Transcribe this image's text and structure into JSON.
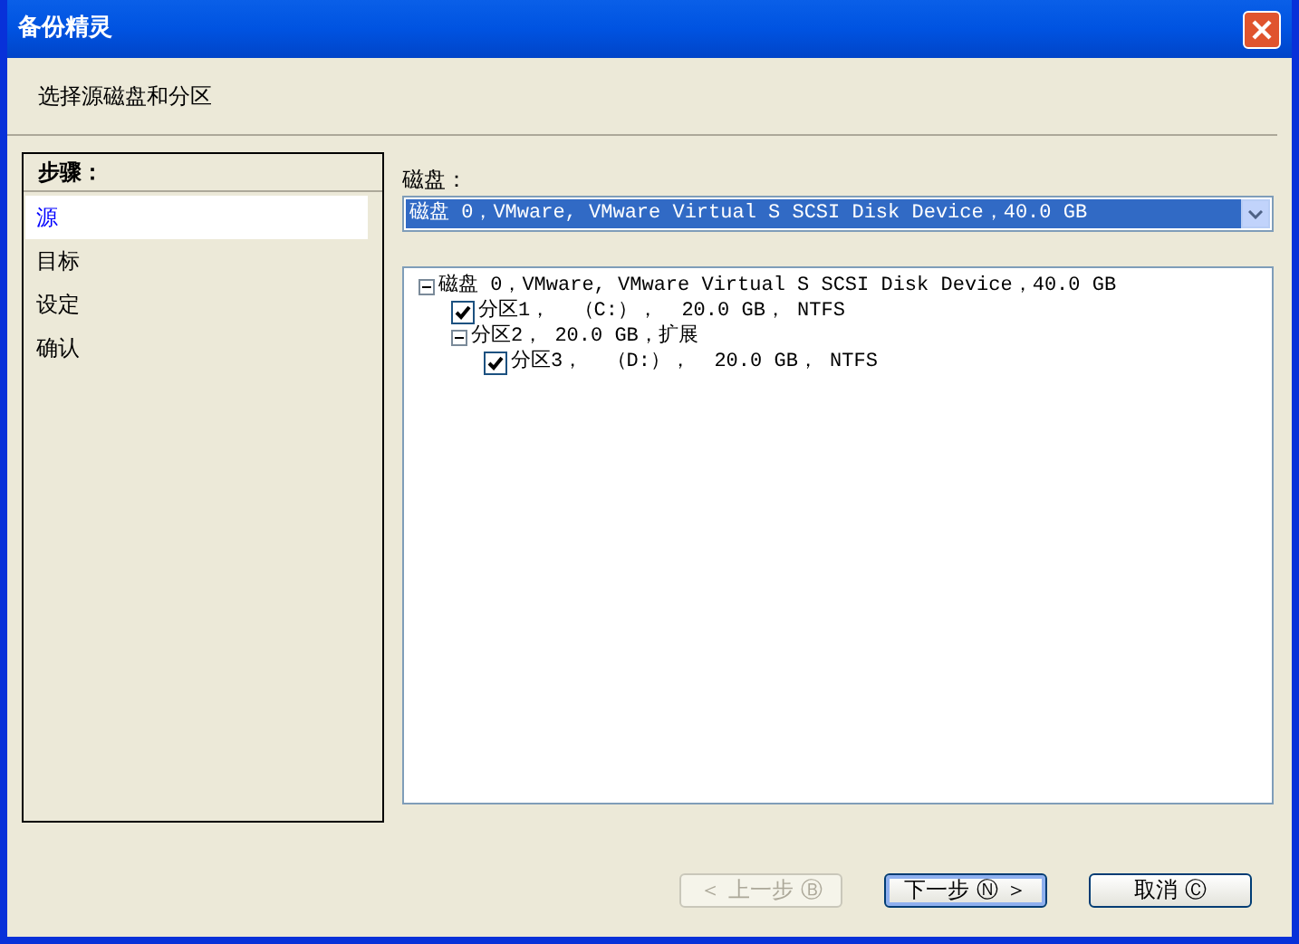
{
  "window": {
    "title": "备份精灵"
  },
  "header": {
    "subtitle": "选择源磁盘和分区"
  },
  "steps": {
    "title": "步骤：",
    "items": [
      {
        "label": "源",
        "selected": true
      },
      {
        "label": "目标",
        "selected": false
      },
      {
        "label": "设定",
        "selected": false
      },
      {
        "label": "确认",
        "selected": false
      }
    ]
  },
  "disk": {
    "label": "磁盘：",
    "value": "磁盘 0，VMware, VMware Virtual S SCSI Disk Device，40.0 GB"
  },
  "tree": [
    {
      "kind": "expandable",
      "label": "磁盘 0，VMware, VMware Virtual S SCSI Disk Device，40.0 GB",
      "expanded": true,
      "children": [
        {
          "kind": "checkable",
          "label": "分区1，  （C:），  20.0 GB， NTFS",
          "checked": true
        },
        {
          "kind": "expandable",
          "label": "分区2， 20.0 GB，扩展",
          "expanded": true,
          "children": [
            {
              "kind": "checkable",
              "label": "分区3，  （D:），  20.0 GB， NTFS",
              "checked": true
            }
          ]
        }
      ]
    }
  ],
  "buttons": [
    {
      "label": "＜ 上一步 Ⓑ",
      "disabled": true,
      "default": false
    },
    {
      "label": "下一步 Ⓝ ＞",
      "disabled": false,
      "default": true
    },
    {
      "label": "取消 Ⓒ",
      "disabled": false,
      "default": false
    }
  ]
}
